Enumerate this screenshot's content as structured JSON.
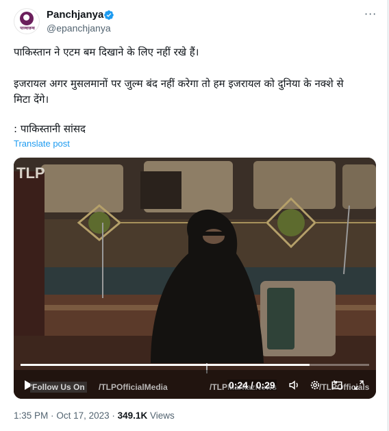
{
  "author": {
    "display_name": "Panchjanya",
    "handle": "@epanchjanya",
    "avatar_brand": "पाञ्चजन्य",
    "verified_icon": "verified-badge-icon",
    "verified_color": "#1d9bf0"
  },
  "menu": {
    "icon": "more-horizontal-icon",
    "label": "···"
  },
  "post": {
    "line1": "पाकिस्तान ने एटम बम दिखाने के लिए नहीं रखे हैं।",
    "line2": "इजरायल अगर मुसलमानों पर जुल्म बंद नहीं करेगा तो हम इजरायल को दुनिया के नक्शे से",
    "line3": "मिटा देंगे।",
    "line4": ": पाकिस्तानी सांसद",
    "translate_label": "Translate post"
  },
  "video": {
    "watermark": "TLP",
    "overlay_follow": "Follow Us On",
    "overlay_media": "/TLPOfficialMedia",
    "overlay_markaz": "/TLPMarkazNews",
    "overlay_official": "/TLPOfficials",
    "time_current": "0:24",
    "time_total": "0:29",
    "time_display": "0:24 / 0:29",
    "progress": 0.83,
    "controls": [
      "play-icon",
      "volume-icon",
      "settings-icon",
      "pip-icon",
      "fullscreen-icon"
    ]
  },
  "meta": {
    "time": "1:35 PM",
    "date": "Oct 17, 2023",
    "separator": "·",
    "views_count": "349.1K",
    "views_label": "Views"
  },
  "colors": {
    "accent": "#1d9bf0",
    "text": "#0f1419",
    "muted": "#536471"
  }
}
